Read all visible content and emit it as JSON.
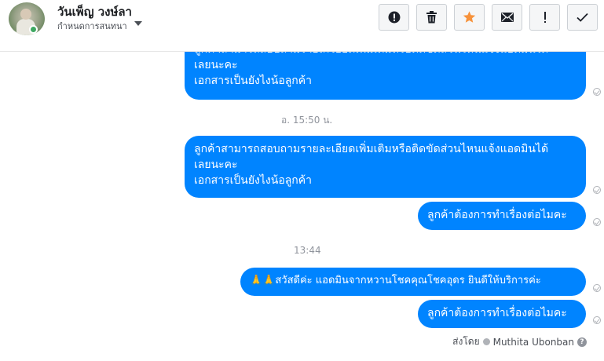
{
  "header": {
    "contact_name": "วันเพ็ญ วงษ์ลา",
    "assign_label": "กำหนดการสนทนา",
    "toolbar": [
      {
        "name": "spam-button",
        "icon": "alert-circle-icon"
      },
      {
        "name": "delete-button",
        "icon": "trash-icon"
      },
      {
        "name": "star-button",
        "icon": "star-icon"
      },
      {
        "name": "mark-unread-button",
        "icon": "envelope-icon"
      },
      {
        "name": "follow-up-button",
        "icon": "exclamation-icon"
      },
      {
        "name": "mark-done-button",
        "icon": "checkmark-icon"
      }
    ],
    "star_color": "#f7923b"
  },
  "messages": [
    {
      "lines": [
        "ลูกค้าสามารถสอบถามรายละเอียดเพิ่มเติมหรือติดขัดส่วนไหนแจ้งแอดมินได้",
        "เลยนะคะ",
        "เอกสารเป็นยังไงน้อลูกค้า"
      ]
    },
    {
      "time": "อ. 15:50 น."
    },
    {
      "lines": [
        "ลูกค้าสามารถสอบถามรายละเอียดเพิ่มเติมหรือติดขัดส่วนไหนแจ้งแอดมินได้",
        "เลยนะคะ",
        "เอกสารเป็นยังไงน้อลูกค้า"
      ]
    },
    {
      "lines": [
        "ลูกค้าต้องการทำเรื่องต่อไมคะ"
      ]
    },
    {
      "time": "13:44"
    },
    {
      "lines": [
        "🙏🙏สวัสดีค่ะ แอดมินจากหวานโชคคุณโชคอุดร ยินดีให้บริการค่ะ"
      ]
    },
    {
      "lines": [
        "ลูกค้าต้องการทำเรื่องต่อไมคะ"
      ]
    }
  ],
  "sent_by": {
    "label": "ส่งโดย",
    "name": "Muthita Ubonban"
  },
  "bubble_color": "#0084ff"
}
